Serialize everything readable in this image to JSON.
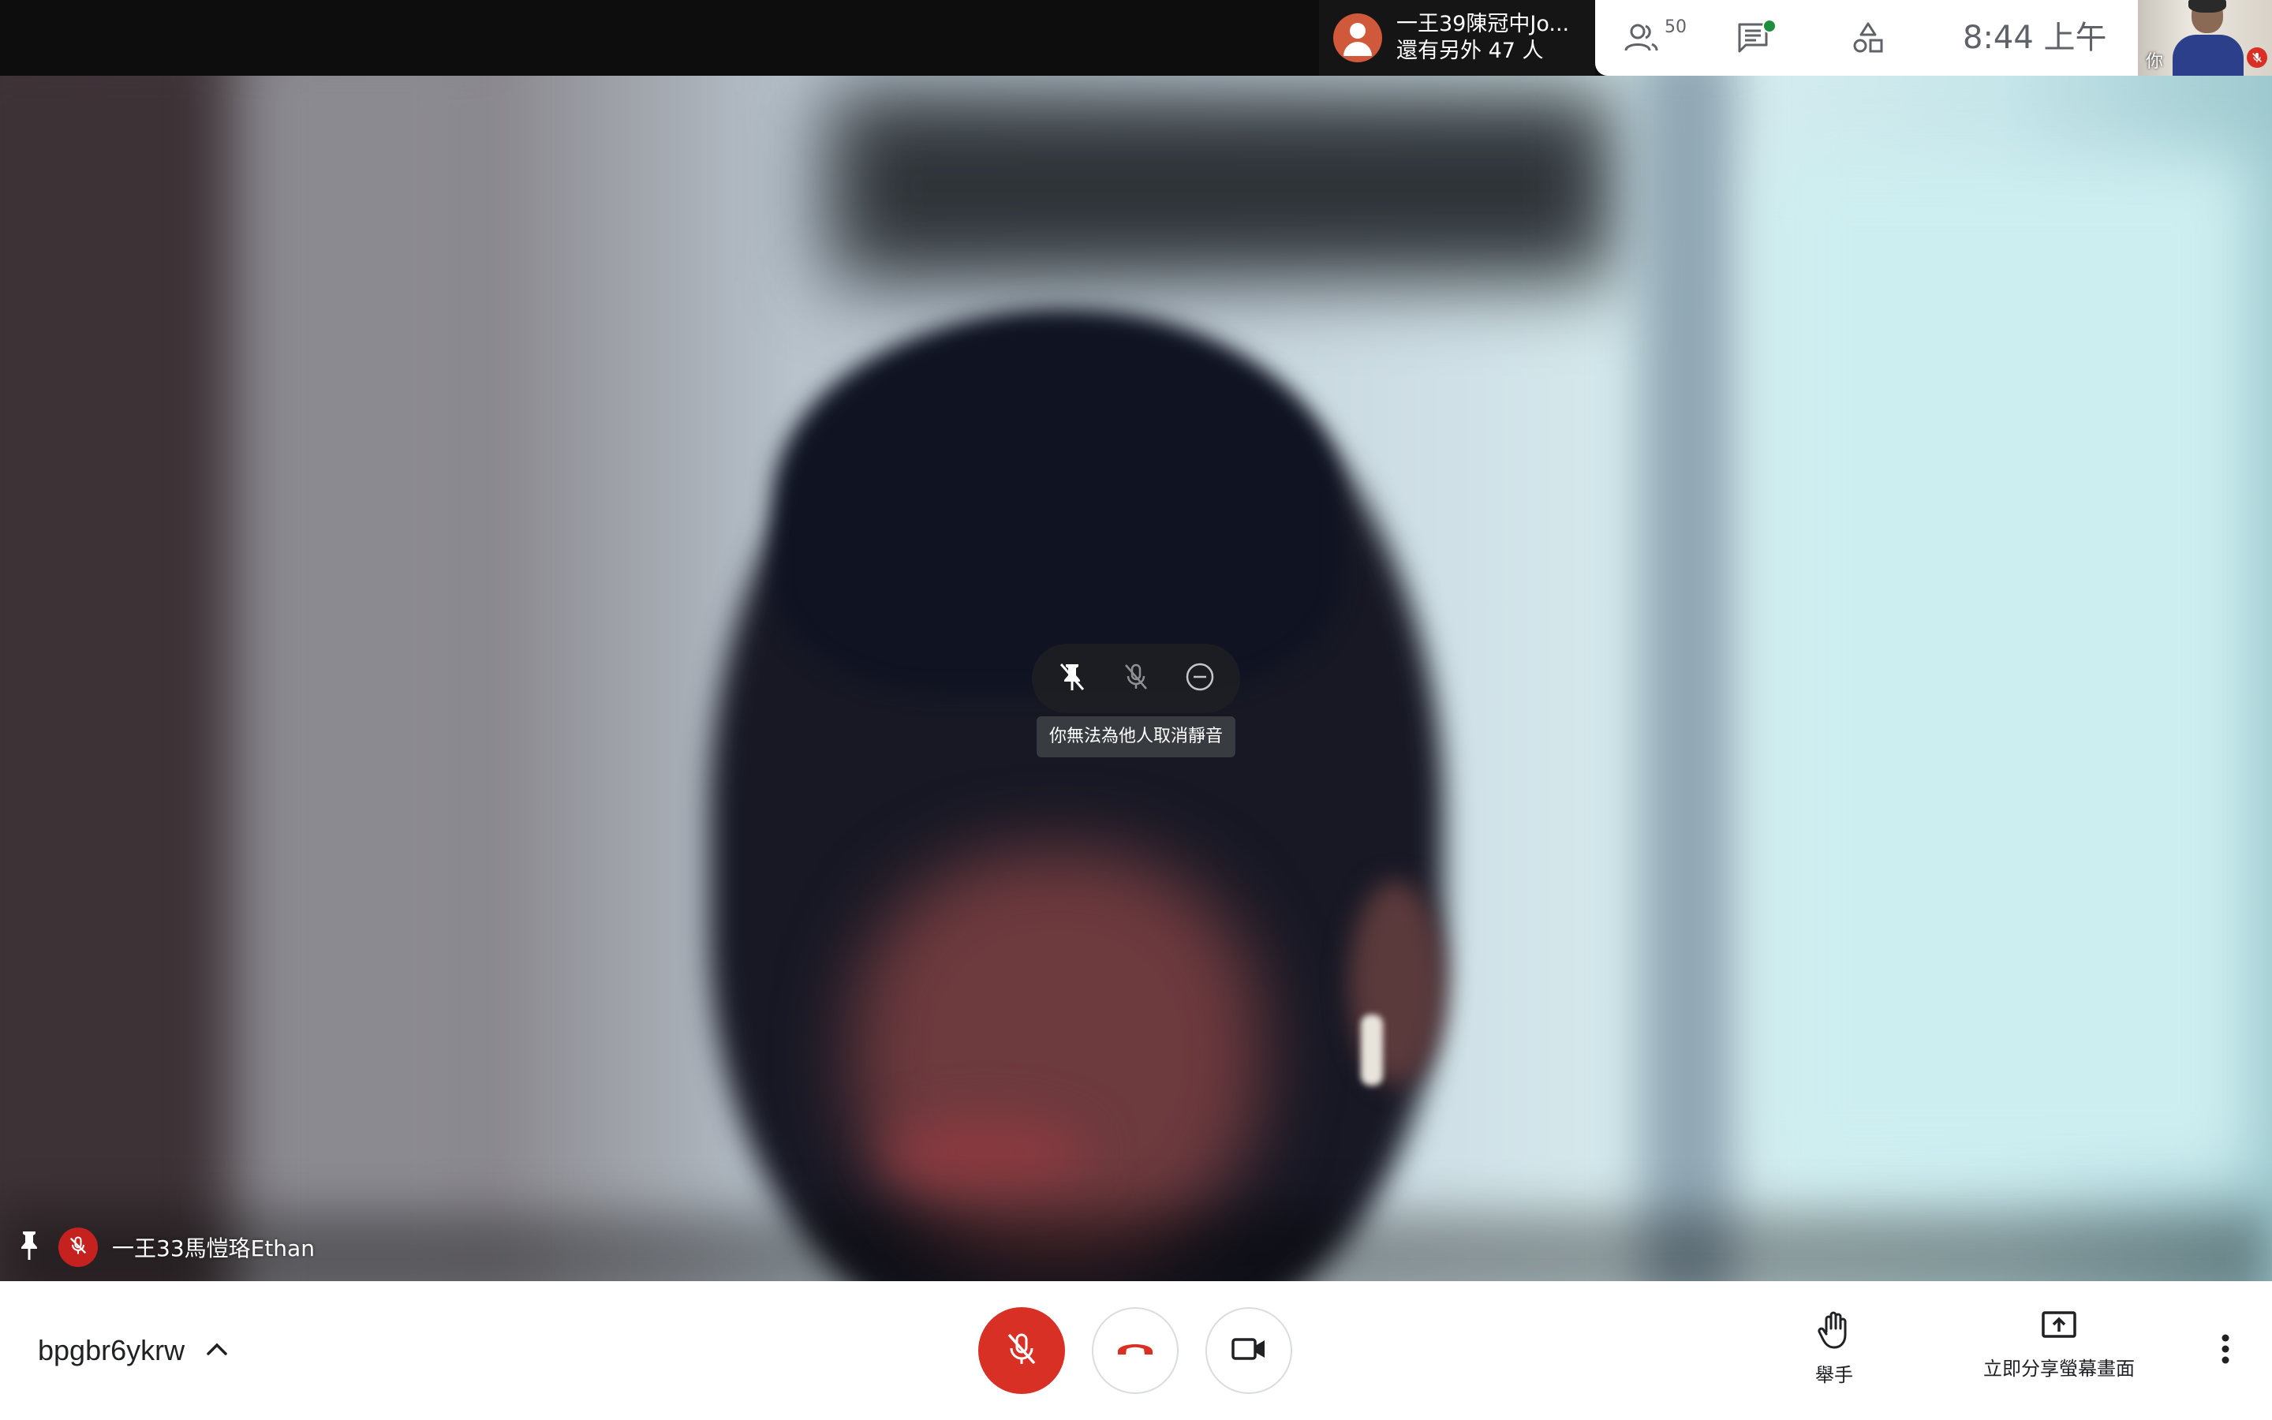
{
  "top_bar": {
    "presenter": {
      "name": "一王39陳冠中Jo...",
      "others": "還有另外 47 人"
    },
    "people": {
      "icon": "people-icon",
      "count": "50"
    },
    "chat": {
      "icon": "chat-icon",
      "has_unread": true
    },
    "activities": {
      "icon": "activities-icon"
    },
    "clock": "8:44  上午",
    "self_view": {
      "label": "你",
      "muted": true
    }
  },
  "main_tile": {
    "participant_name": "一王33馬愷珞Ethan",
    "muted": true,
    "pinned": true,
    "hover_controls": [
      "unpin-icon",
      "mic-off-icon",
      "remove-icon"
    ],
    "tooltip": "你無法為他人取消靜音"
  },
  "bottom_bar": {
    "meeting_code": "bpgbr6ykrw",
    "mic_muted": true,
    "raise_hand_label": "舉手",
    "present_label": "立即分享螢幕畫面"
  },
  "colors": {
    "mute_red": "#d93025",
    "presenter_avatar": "#d0583b",
    "chat_dot": "#1e8e3e",
    "icon_gray": "#5f6368"
  }
}
